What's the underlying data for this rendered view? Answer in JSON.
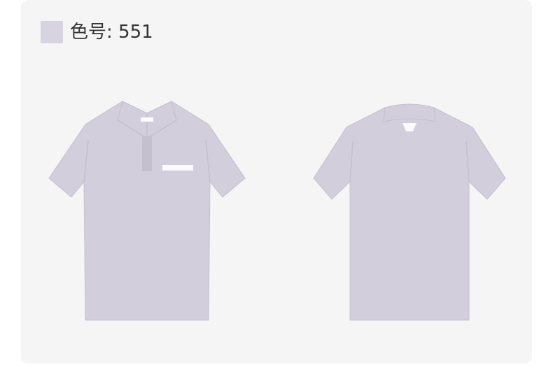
{
  "color_label": "色号: 551",
  "swatch_color": "#d7d3e0",
  "shirt_color": "#d2cedc",
  "shirt_shade": "#c4c0ce",
  "front_view": {
    "icon": "polo-shirt-front",
    "logo": "columbia-logo"
  },
  "back_view": {
    "icon": "polo-shirt-back",
    "logo": "pfg-logo"
  }
}
